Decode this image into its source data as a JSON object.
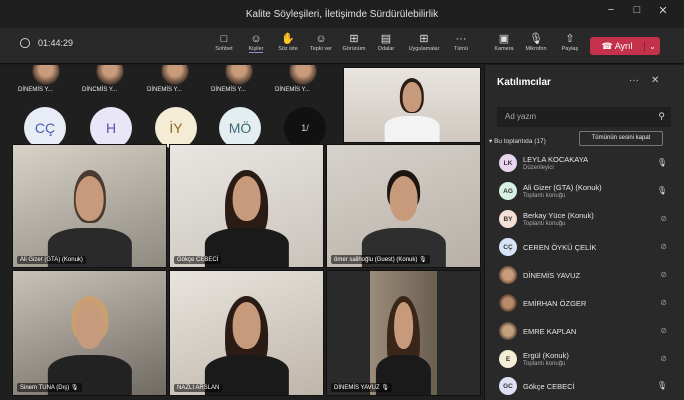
{
  "window": {
    "title": "Kalite Söyleşileri, İletişimde Sürdürülebilirlik",
    "minimize": "−",
    "maximize": "□",
    "close": "✕"
  },
  "toolbar": {
    "timer": "01:44:29",
    "buttons": [
      {
        "label": "Sohbet",
        "icon": "chat-icon"
      },
      {
        "label": "Kişiler",
        "icon": "people-icon"
      },
      {
        "label": "Söz iste",
        "icon": "raise-hand-icon"
      },
      {
        "label": "Tepki ver",
        "icon": "emoji-icon"
      },
      {
        "label": "Görünüm",
        "icon": "layout-icon"
      },
      {
        "label": "Odalar",
        "icon": "rooms-icon"
      },
      {
        "label": "Uygulamalar",
        "icon": "apps-icon"
      },
      {
        "label": "Tümü",
        "icon": "more-icon"
      },
      {
        "label": "Kamera",
        "icon": "camera-icon"
      },
      {
        "label": "Mikrofon",
        "icon": "microphone-icon"
      },
      {
        "label": "Paylaş",
        "icon": "share-icon"
      }
    ],
    "leave_label": "Ayrıl",
    "leave_color": "#c4314b"
  },
  "stage": {
    "top_row": [
      "DİNEMİS Y...",
      "DİNCMİS Y...",
      "DİNEMİS Y...",
      "DİNEMİS Y...",
      "DİNEMİS Y..."
    ],
    "avatars": [
      {
        "initials": "CÇ",
        "color": "#e8ecf7",
        "text": "#4a5fb0"
      },
      {
        "initials": "H",
        "color": "#e8e6f7",
        "text": "#5b4fb0"
      },
      {
        "initials": "İY",
        "color": "#f5ecd6",
        "text": "#8a6b1e"
      },
      {
        "initials": "MÖ",
        "color": "#e4eef0",
        "text": "#3a6a76"
      },
      {
        "initials": "1/",
        "color": "#111111",
        "text": "#dddddd"
      }
    ],
    "tiles": [
      {
        "name": "Ali Gizer (GTA) (Konuk)"
      },
      {
        "name": "Gökçe CEBECİ"
      },
      {
        "name": "ömer salihoğlu (Guest) (Konuk)"
      },
      {
        "name": "Sinem TUNA (Dış)"
      },
      {
        "name": "NAZLI ARSLAN"
      },
      {
        "name": "DİNEMİS YAVUZ"
      }
    ]
  },
  "panel": {
    "title": "Katılımcılar",
    "more": "···",
    "close": "✕",
    "search_placeholder": "Ad yazın",
    "section": "Bu toplantıda (17)",
    "mute_all": "Tümünün sesini kapat",
    "participants": [
      {
        "initials": "LK",
        "name": "LEYLA KOCAKAYA",
        "role": "Düzenleyici",
        "color": "#e8d6f0",
        "mic": "on"
      },
      {
        "initials": "AG",
        "name": "Ali Gizer (GTA) (Konuk)",
        "role": "Toplantı konuğu",
        "color": "#d6f0e4",
        "mic": "on"
      },
      {
        "initials": "BY",
        "name": "Berkay Yüce (Konuk)",
        "role": "Toplantı konuğu",
        "color": "#f5e0d6",
        "mic": "off"
      },
      {
        "initials": "CÇ",
        "name": "CEREN ÖYKÜ ÇELİK",
        "role": "",
        "color": "#d6e4f5",
        "mic": "off"
      },
      {
        "initials": "",
        "name": "DİNEMİS YAVUZ",
        "role": "",
        "color": "#b08060",
        "mic": "off"
      },
      {
        "initials": "",
        "name": "EMİRHAN ÖZGER",
        "role": "",
        "color": "#9a7a66",
        "mic": "off"
      },
      {
        "initials": "",
        "name": "EMRE KAPLAN",
        "role": "",
        "color": "#8a7060",
        "mic": "off"
      },
      {
        "initials": "E",
        "name": "Ergül (Konuk)",
        "role": "Toplantı konuğu",
        "color": "#f5ecd6",
        "mic": "off"
      },
      {
        "initials": "GC",
        "name": "Gökçe CEBECİ",
        "role": "",
        "color": "#e0e0f5",
        "mic": "on"
      }
    ]
  }
}
